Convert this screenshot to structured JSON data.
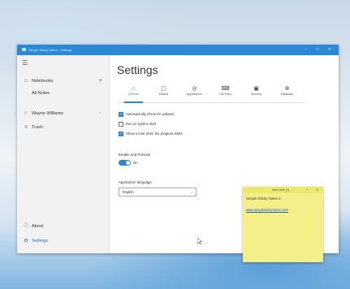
{
  "window": {
    "title": "Simple Sticky Notes - Settings",
    "controls": {
      "minimize": "–",
      "maximize": "□",
      "close": "✕"
    }
  },
  "sidebar": {
    "items": [
      {
        "icon": "notebook-icon",
        "glyph": "□",
        "label": "Notebooks",
        "trail": "+"
      },
      {
        "label": "All Notes"
      },
      {
        "icon": "pen-icon",
        "glyph": "∕",
        "label": "Wayne Williams",
        "trail": "›"
      },
      {
        "icon": "trash-icon",
        "glyph": "≡",
        "label": "Trash"
      },
      {
        "icon": "info-icon",
        "glyph": "ⓘ",
        "label": "About"
      },
      {
        "icon": "gear-icon",
        "glyph": "⚙",
        "label": "Settings"
      }
    ]
  },
  "page": {
    "title": "Settings"
  },
  "tabs": [
    {
      "icon": "general-icon",
      "glyph": "⌂",
      "label": "General"
    },
    {
      "icon": "default-icon",
      "glyph": "▢",
      "label": "Default"
    },
    {
      "icon": "appearance-icon",
      "glyph": "◎",
      "label": "Appearance"
    },
    {
      "icon": "hotkeys-icon",
      "glyph": "⌨",
      "label": "Hot Keys"
    },
    {
      "icon": "security-icon",
      "glyph": "▣",
      "label": "Security"
    },
    {
      "icon": "database-icon",
      "glyph": "⊕",
      "label": "Database"
    }
  ],
  "options": [
    {
      "label": "Automatically check for updates",
      "checked": true
    },
    {
      "label": "Run on system start",
      "checked": false
    },
    {
      "label": "Show a note when the program starts",
      "checked": true
    }
  ],
  "freeze": {
    "label": "Enable and Preview",
    "state": "On"
  },
  "language": {
    "label": "Application language",
    "value": "English"
  },
  "note": {
    "bar_title": "New Note (1)",
    "title": "Simple Sticky Notes 4",
    "link": "www.simplestickynotes.com",
    "add": "+",
    "close": "✕"
  },
  "colors": {
    "accent": "#2b88d8",
    "note": "#f4f089"
  }
}
